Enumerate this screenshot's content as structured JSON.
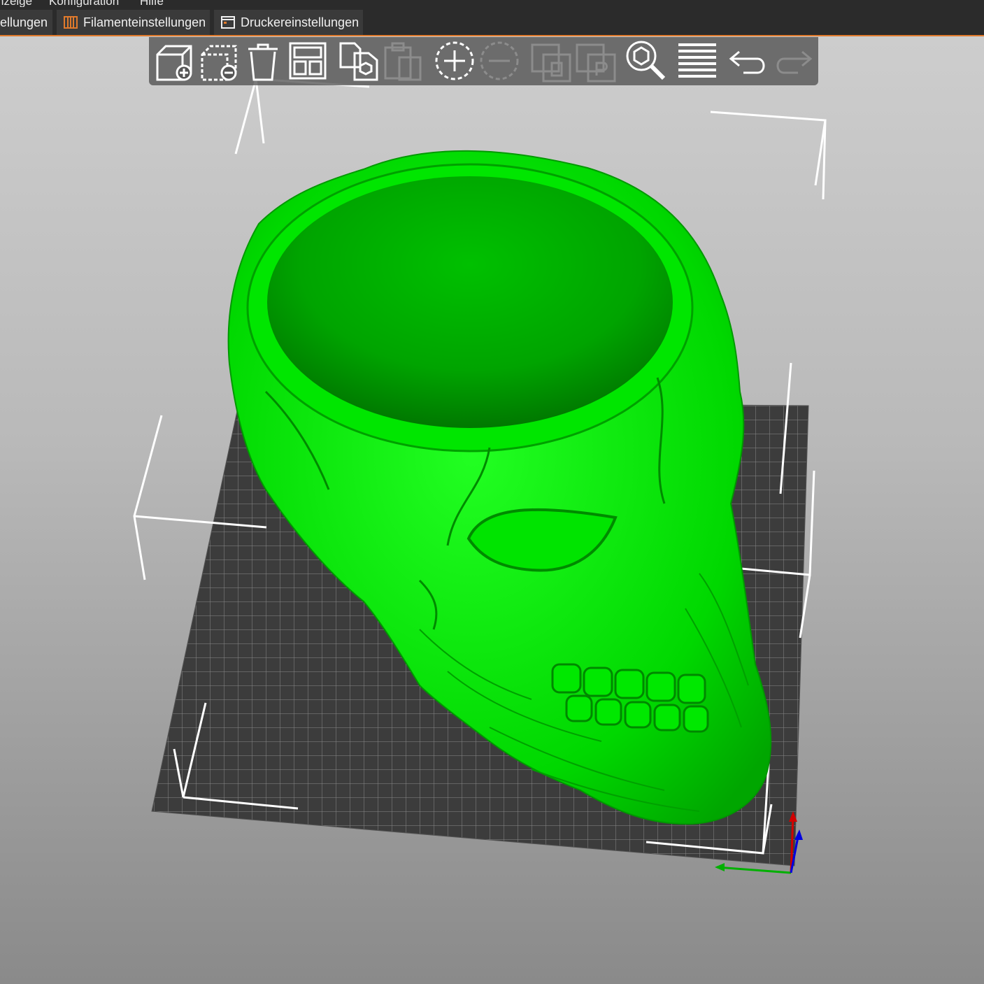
{
  "menu": {
    "items": [
      "nzeige",
      "Konfiguration",
      "Hilfe"
    ]
  },
  "tabs": [
    {
      "label": "ellungen",
      "icon": "settings-icon"
    },
    {
      "label": "Filamenteinstellungen",
      "icon": "filament-spool-icon"
    },
    {
      "label": "Druckereinstellungen",
      "icon": "printer-settings-icon"
    }
  ],
  "toolbar": {
    "buttons": [
      {
        "name": "add-object-button",
        "icon": "add-cube-icon",
        "enabled": true
      },
      {
        "name": "delete-object-button",
        "icon": "remove-cube-icon",
        "enabled": true
      },
      {
        "name": "delete-all-button",
        "icon": "trash-icon",
        "enabled": true
      },
      {
        "name": "arrange-button",
        "icon": "arrange-icon",
        "enabled": true
      },
      {
        "name": "copy-button",
        "icon": "copy-icon",
        "enabled": true
      },
      {
        "name": "paste-button",
        "icon": "paste-icon",
        "enabled": false
      },
      {
        "name": "add-instance-button",
        "icon": "add-instance-icon",
        "enabled": true
      },
      {
        "name": "remove-instance-button",
        "icon": "remove-instance-icon",
        "enabled": false
      },
      {
        "name": "split-to-objects-button",
        "icon": "split-objects-icon",
        "enabled": false
      },
      {
        "name": "split-to-parts-button",
        "icon": "split-parts-icon",
        "enabled": false
      },
      {
        "name": "search-button",
        "icon": "search-icon",
        "enabled": true
      },
      {
        "name": "layers-editing-button",
        "icon": "layers-icon",
        "enabled": true
      },
      {
        "name": "undo-button",
        "icon": "undo-icon",
        "enabled": true
      },
      {
        "name": "redo-button",
        "icon": "redo-icon",
        "enabled": false
      }
    ]
  },
  "colors": {
    "model": "#00dd00",
    "bed": "#3c3c3c",
    "accent": "#e07a2c",
    "axis_x": "#d00000",
    "axis_y": "#00b000",
    "axis_z": "#0000e0"
  }
}
